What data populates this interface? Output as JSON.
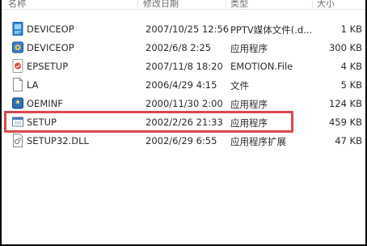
{
  "columns": {
    "name": "名称",
    "date": "修改日期",
    "type": "类型",
    "size": "大小"
  },
  "files": [
    {
      "name": "DEVICEOP",
      "date": "2007/10/25 12:56",
      "type": "PPTV媒体文件(.d...",
      "size": "1 KB",
      "icon": "media-file-icon"
    },
    {
      "name": "DEVICEOP",
      "date": "2002/6/8 2:25",
      "type": "应用程序",
      "size": "300 KB",
      "icon": "application-icon"
    },
    {
      "name": "EPSETUP",
      "date": "2007/11/8 18:20",
      "type": "EMOTION.File",
      "size": "4 KB",
      "icon": "emotion-file-icon"
    },
    {
      "name": "LA",
      "date": "2006/4/29 4:15",
      "type": "文件",
      "size": "5 KB",
      "icon": "blank-file-icon"
    },
    {
      "name": "OEMINF",
      "date": "2000/11/30 2:00",
      "type": "应用程序",
      "size": "124 KB",
      "icon": "application-icon"
    },
    {
      "name": "SETUP",
      "date": "2002/2/26 21:33",
      "type": "应用程序",
      "size": "459 KB",
      "icon": "setup-window-icon",
      "highlighted": true
    },
    {
      "name": "SETUP32.DLL",
      "date": "2002/6/29 6:55",
      "type": "应用程序扩展",
      "size": "47 KB",
      "icon": "dll-file-icon"
    }
  ],
  "highlight_color": "#d9484f"
}
